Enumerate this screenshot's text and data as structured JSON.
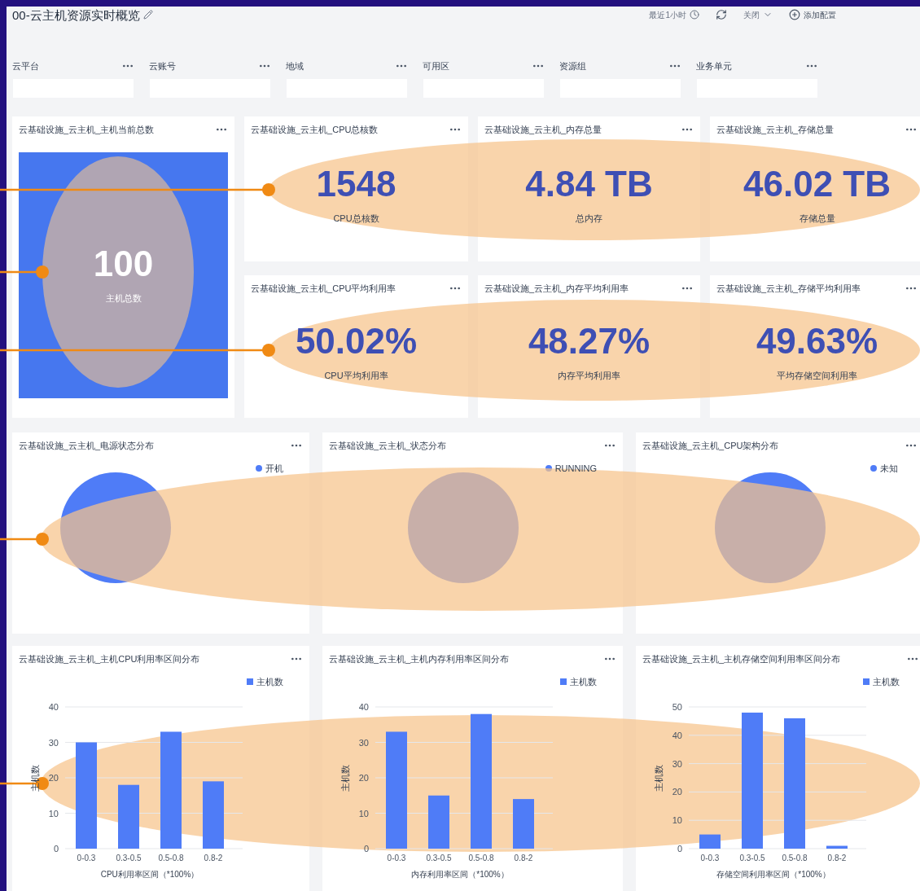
{
  "title": "00-云主机资源实时概览",
  "toolbar": [
    {
      "kind": "time",
      "label": "最近1小时"
    },
    {
      "kind": "refresh"
    },
    {
      "kind": "dropdown",
      "label": "关闭"
    },
    {
      "kind": "add",
      "label": "添加配置"
    }
  ],
  "filters": [
    {
      "label": "云平台"
    },
    {
      "label": "云账号"
    },
    {
      "label": "地域"
    },
    {
      "label": "可用区"
    },
    {
      "label": "资源组"
    },
    {
      "label": "业务单元"
    }
  ],
  "stat_cards": [
    {
      "kind": "highlight",
      "title": "云基础设施_云主机_主机当前总数",
      "value": "100",
      "label": "主机总数"
    },
    {
      "kind": "plain",
      "title": "云基础设施_云主机_CPU总核数",
      "value": "1548",
      "label": "CPU总核数"
    },
    {
      "kind": "plain",
      "title": "云基础设施_云主机_内存总量",
      "value": "4.84 TB",
      "label": "总内存"
    },
    {
      "kind": "plain",
      "title": "云基础设施_云主机_存储总量",
      "value": "46.02 TB",
      "label": "存储总量"
    },
    {
      "kind": "plain",
      "title": "云基础设施_云主机_CPU平均利用率",
      "value": "50.02%",
      "label": "CPU平均利用率"
    },
    {
      "kind": "plain",
      "title": "云基础设施_云主机_内存平均利用率",
      "value": "48.27%",
      "label": "内存平均利用率"
    },
    {
      "kind": "plain",
      "title": "云基础设施_云主机_存储平均利用率",
      "value": "49.63%",
      "label": "平均存储空间利用率"
    }
  ],
  "pie_cards": [
    {
      "title": "云基础设施_云主机_电源状态分布",
      "legend": "开机",
      "color": "#4f7cf7"
    },
    {
      "title": "云基础设施_云主机_状态分布",
      "legend": "RUNNING",
      "color": "#4f7cf7"
    },
    {
      "title": "云基础设施_云主机_CPU架构分布",
      "legend": "未知",
      "color": "#4f7cf7"
    }
  ],
  "bar_cards": [
    {
      "title": "云基础设施_云主机_主机CPU利用率区间分布",
      "chart_data": {
        "type": "bar",
        "xlabel": "CPU利用率区间（*100%）",
        "ylabel": "主机数",
        "categories": [
          "0-0.3",
          "0.3-0.5",
          "0.5-0.8",
          "0.8-2"
        ],
        "series": [
          {
            "name": "主机数",
            "color": "#4f7cf7",
            "values": [
              30,
              18,
              33,
              19
            ]
          }
        ],
        "grid": true,
        "ylim": [
          0,
          40
        ],
        "yticks": [
          0,
          10,
          20,
          30,
          40
        ]
      }
    },
    {
      "title": "云基础设施_云主机_主机内存利用率区间分布",
      "chart_data": {
        "type": "bar",
        "xlabel": "内存利用率区间（*100%）",
        "ylabel": "主机数",
        "categories": [
          "0-0.3",
          "0.3-0.5",
          "0.5-0.8",
          "0.8-2"
        ],
        "series": [
          {
            "name": "主机数",
            "color": "#4f7cf7",
            "values": [
              33,
              15,
              38,
              14
            ]
          }
        ],
        "grid": true,
        "ylim": [
          0,
          40
        ],
        "yticks": [
          0,
          10,
          20,
          30,
          40
        ]
      }
    },
    {
      "title": "云基础设施_云主机_主机存储空间利用率区间分布",
      "chart_data": {
        "type": "bar",
        "xlabel": "存储空间利用率区间（*100%）",
        "ylabel": "主机数",
        "categories": [
          "0-0.3",
          "0.3-0.5",
          "0.5-0.8",
          "0.8-2"
        ],
        "series": [
          {
            "name": "主机数",
            "color": "#4f7cf7",
            "values": [
              5,
              48,
              46,
              1
            ]
          }
        ],
        "grid": true,
        "ylim": [
          0,
          50
        ],
        "yticks": [
          0,
          10,
          20,
          30,
          40,
          50
        ]
      }
    }
  ]
}
